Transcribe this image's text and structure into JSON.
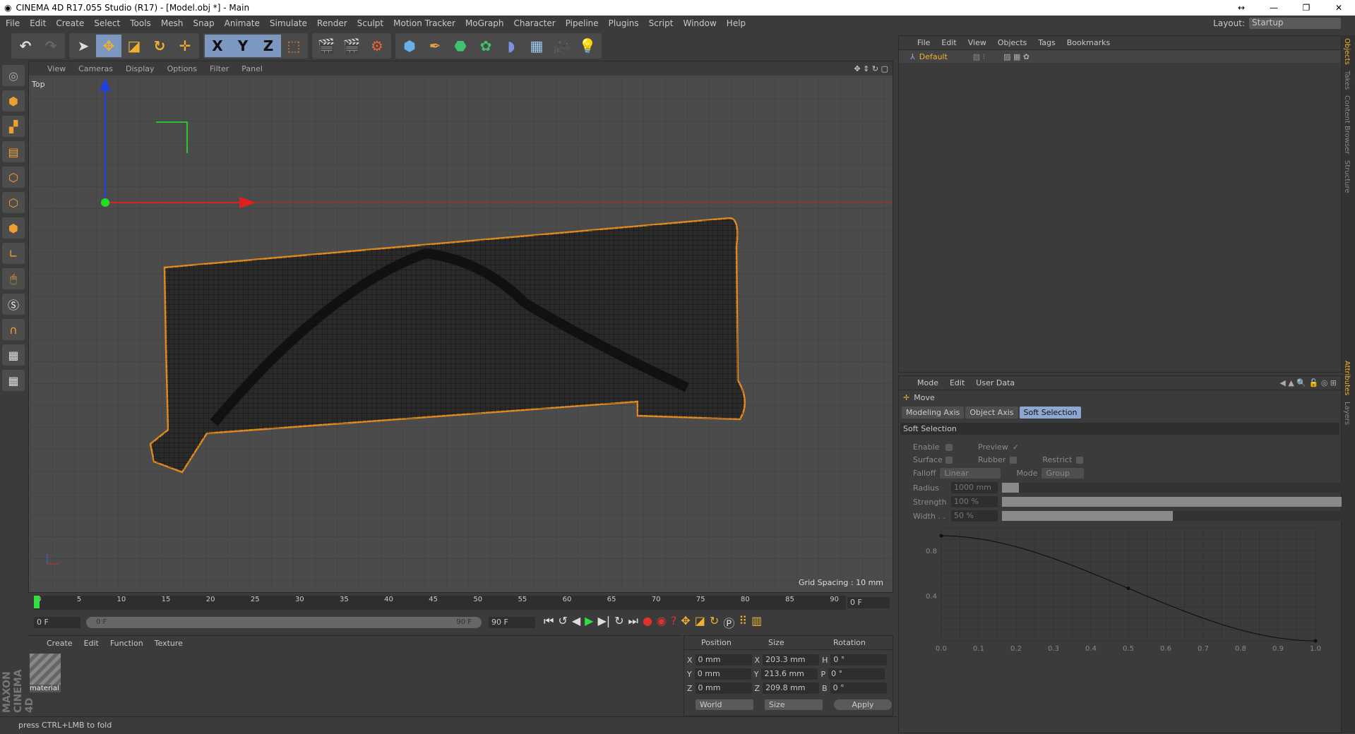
{
  "window": {
    "title": "CINEMA 4D R17.055 Studio (R17) - [Model.obj *] - Main",
    "controls": [
      "↔",
      "—",
      "❐",
      "✕"
    ]
  },
  "menu": [
    "File",
    "Edit",
    "Create",
    "Select",
    "Tools",
    "Mesh",
    "Snap",
    "Animate",
    "Simulate",
    "Render",
    "Sculpt",
    "Motion Tracker",
    "MoGraph",
    "Character",
    "Pipeline",
    "Plugins",
    "Script",
    "Window",
    "Help"
  ],
  "layout": {
    "label": "Layout:",
    "value": "Startup"
  },
  "toolbar": {
    "axis": [
      "X",
      "Y",
      "Z"
    ]
  },
  "viewport": {
    "menu": [
      "View",
      "Cameras",
      "Display",
      "Options",
      "Filter",
      "Panel"
    ],
    "name": "Top",
    "grid_spacing": "Grid Spacing : 10 mm"
  },
  "timeline": {
    "ticks": [
      "0",
      "5",
      "10",
      "15",
      "20",
      "25",
      "30",
      "35",
      "40",
      "45",
      "50",
      "55",
      "60",
      "65",
      "70",
      "75",
      "80",
      "85",
      "90"
    ],
    "current_frame": "0 F",
    "start": "0 F",
    "range_start": "0 F",
    "range_end": "90 F",
    "end": "90 F"
  },
  "materials": {
    "menu": [
      "Create",
      "Edit",
      "Function",
      "Texture"
    ],
    "items": [
      {
        "name": "material"
      }
    ]
  },
  "coords": {
    "headers": [
      "Position",
      "Size",
      "Rotation"
    ],
    "rows": [
      {
        "a": "X",
        "pos": "0 mm",
        "s": "X",
        "size": "203.3 mm",
        "r": "H",
        "rot": "0 °"
      },
      {
        "a": "Y",
        "pos": "0 mm",
        "s": "Y",
        "size": "213.6 mm",
        "r": "P",
        "rot": "0 °"
      },
      {
        "a": "Z",
        "pos": "0 mm",
        "s": "Z",
        "size": "209.8 mm",
        "r": "B",
        "rot": "0 °"
      }
    ],
    "space": "World",
    "mode": "Size",
    "apply": "Apply"
  },
  "status": "press CTRL+LMB to fold",
  "brand": "MAXON CINEMA 4D",
  "objects": {
    "menu": [
      "File",
      "Edit",
      "View",
      "Objects",
      "Tags",
      "Bookmarks"
    ],
    "items": [
      {
        "name": "Default"
      }
    ]
  },
  "attributes": {
    "menu": [
      "Mode",
      "Edit",
      "User Data"
    ],
    "tool": "Move",
    "tabs": [
      "Modeling Axis",
      "Object Axis",
      "Soft Selection"
    ],
    "active_tab": "Soft Selection",
    "section": "Soft Selection",
    "enable": "Enable",
    "preview": "Preview",
    "surface": "Surface",
    "rubber": "Rubber",
    "restrict": "Restrict",
    "falloff_label": "Falloff",
    "falloff": "Linear",
    "mode_label": "Mode",
    "mode": "Group",
    "radius_label": "Radius",
    "radius": "1000 mm",
    "radius_fill": 0.05,
    "strength_label": "Strength",
    "strength": "100 %",
    "strength_fill": 1.0,
    "width_label": "Width . .",
    "width": "50 %",
    "width_fill": 0.5,
    "graph": {
      "x_ticks": [
        "0.0",
        "0.1",
        "0.2",
        "0.3",
        "0.4",
        "0.5",
        "0.6",
        "0.7",
        "0.8",
        "0.9",
        "1.0"
      ],
      "y_ticks": [
        "0.8",
        "0.4"
      ]
    }
  },
  "right_tabs": [
    "Objects",
    "Takes",
    "Content Browser",
    "Structure",
    "Attributes",
    "Layers"
  ]
}
